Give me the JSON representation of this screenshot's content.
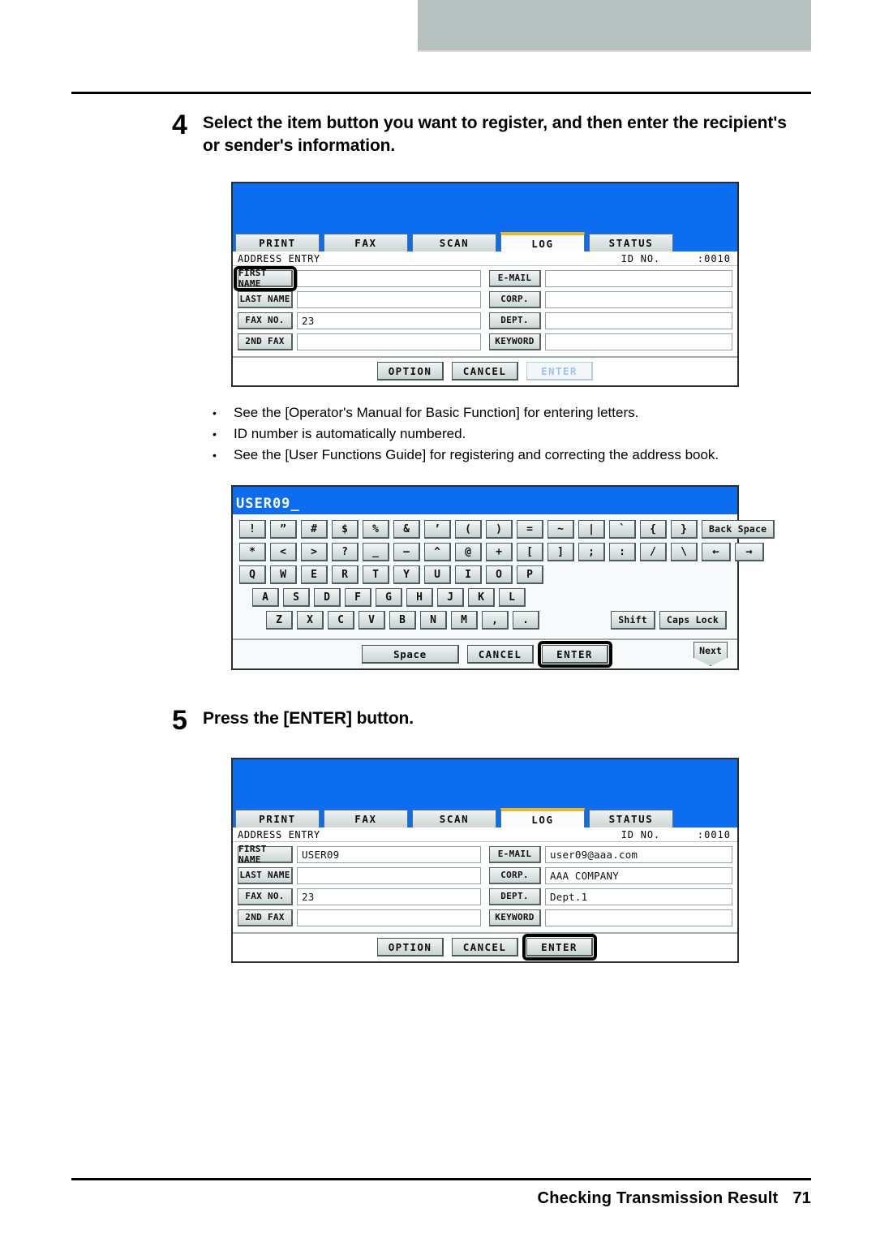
{
  "footer": {
    "title": "Checking Transmission Result",
    "page": "71"
  },
  "steps": [
    {
      "number": "4",
      "text": "Select the item button you want to register, and then enter the recipient's or sender's information."
    },
    {
      "number": "5",
      "text": "Press the [ENTER] button."
    }
  ],
  "notes": {
    "bullet": "•",
    "items": [
      "See the [Operator's Manual for Basic Function] for entering letters.",
      "ID number is automatically numbered.",
      "See the [User Functions Guide] for registering and correcting the address book."
    ]
  },
  "tabs": [
    {
      "label": "PRINT",
      "active": false
    },
    {
      "label": "FAX",
      "active": false
    },
    {
      "label": "SCAN",
      "active": false
    },
    {
      "label": "LOG",
      "active": true
    },
    {
      "label": "STATUS",
      "active": false
    }
  ],
  "screen_empty": {
    "screen_title": "ADDRESS ENTRY",
    "id_label": "ID NO.",
    "id_value": ":0010",
    "left_fields": [
      {
        "button": "FIRST NAME",
        "value": "",
        "highlighted": true
      },
      {
        "button": "LAST NAME",
        "value": "",
        "highlighted": false
      },
      {
        "button": "FAX NO.",
        "value": "23",
        "highlighted": false
      },
      {
        "button": "2ND FAX",
        "value": "",
        "highlighted": false
      }
    ],
    "right_fields": [
      {
        "button": "E-MAIL",
        "value": "",
        "highlighted": false
      },
      {
        "button": "CORP.",
        "value": "",
        "highlighted": false
      },
      {
        "button": "DEPT.",
        "value": "",
        "highlighted": false
      },
      {
        "button": "KEYWORD",
        "value": "",
        "highlighted": false
      }
    ],
    "actions": [
      {
        "label": "OPTION",
        "disabled": false,
        "highlighted": false
      },
      {
        "label": "CANCEL",
        "disabled": false,
        "highlighted": false
      },
      {
        "label": "ENTER",
        "disabled": true,
        "highlighted": false
      }
    ]
  },
  "screen_filled": {
    "screen_title": "ADDRESS ENTRY",
    "id_label": "ID NO.",
    "id_value": ":0010",
    "left_fields": [
      {
        "button": "FIRST NAME",
        "value": "USER09",
        "highlighted": false
      },
      {
        "button": "LAST NAME",
        "value": "",
        "highlighted": false
      },
      {
        "button": "FAX NO.",
        "value": "23",
        "highlighted": false
      },
      {
        "button": "2ND FAX",
        "value": "",
        "highlighted": false
      }
    ],
    "right_fields": [
      {
        "button": "E-MAIL",
        "value": "user09@aaa.com",
        "highlighted": false
      },
      {
        "button": "CORP.",
        "value": "AAA COMPANY",
        "highlighted": false
      },
      {
        "button": "DEPT.",
        "value": "Dept.1",
        "highlighted": false
      },
      {
        "button": "KEYWORD",
        "value": "",
        "highlighted": false
      }
    ],
    "actions": [
      {
        "label": "OPTION",
        "disabled": false,
        "highlighted": false
      },
      {
        "label": "CANCEL",
        "disabled": false,
        "highlighted": false
      },
      {
        "label": "ENTER",
        "disabled": false,
        "highlighted": true
      }
    ]
  },
  "keyboard": {
    "input_value": "USER09_",
    "rows": [
      {
        "indent": 0,
        "keys": [
          "!",
          "”",
          "#",
          "$",
          "%",
          "&",
          "’",
          "(",
          ")",
          "=",
          "~",
          "|",
          "`",
          "{",
          "}"
        ],
        "extras": [
          {
            "label": "Back Space",
            "type": "wide"
          }
        ]
      },
      {
        "indent": 0,
        "keys": [
          "*",
          "<",
          ">",
          "?",
          "_",
          "—",
          "^",
          "@",
          "+",
          "[",
          "]",
          ";",
          ":",
          "/",
          "\\"
        ],
        "extras": [
          {
            "label": "←",
            "type": "arrow"
          },
          {
            "label": "→",
            "type": "arrow"
          }
        ]
      },
      {
        "indent": 0,
        "keys": [
          "Q",
          "W",
          "E",
          "R",
          "T",
          "Y",
          "U",
          "I",
          "O",
          "P"
        ],
        "extras": []
      },
      {
        "indent": 1,
        "keys": [
          "A",
          "S",
          "D",
          "F",
          "G",
          "H",
          "J",
          "K",
          "L"
        ],
        "extras": []
      },
      {
        "indent": 2,
        "keys": [
          "Z",
          "X",
          "C",
          "V",
          "B",
          "N",
          "M",
          ",",
          "."
        ],
        "extras": [
          {
            "label": "Shift",
            "type": "wide"
          },
          {
            "label": "Caps Lock",
            "type": "wide"
          }
        ]
      }
    ],
    "footer_buttons": [
      {
        "label": "Space",
        "kind": "space"
      },
      {
        "label": "CANCEL",
        "kind": "normal"
      },
      {
        "label": "ENTER",
        "kind": "normal"
      }
    ],
    "next_label": "Next"
  },
  "colors": {
    "lcd_blue": "#0d6df0",
    "tab_active_accent": "#f0b429",
    "header_gray": "#b6c1c0",
    "disabled_text": "#9fc3e8"
  }
}
